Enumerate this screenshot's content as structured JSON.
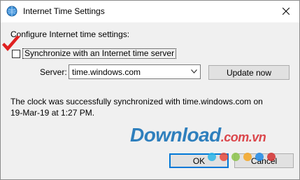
{
  "window": {
    "title": "Internet Time Settings"
  },
  "main": {
    "section_label": "Configure Internet time settings:",
    "sync_label": "Synchronize with an Internet time server",
    "sync_checked": false,
    "server_label": "Server:",
    "server_value": "time.windows.com",
    "update_label": "Update now",
    "status_line1": "The clock was successfully synchronized with time.windows.com on",
    "status_line2": "19-Mar-19 at 1:27 PM."
  },
  "buttons": {
    "ok": "OK",
    "cancel": "Cancel"
  },
  "watermark": {
    "text": "Download",
    "domain": ".com.vn",
    "dot_colors": [
      "#2bb5e8",
      "#e84a3c",
      "#8bc34a",
      "#f5a623",
      "#1e88e5",
      "#d32f2f"
    ]
  },
  "icons": {
    "window_icon": "clock-globe-icon",
    "close": "close-icon",
    "dropdown": "chevron-down-icon",
    "annotation": "red-checkmark-icon"
  },
  "colors": {
    "ok_border": "#0078d7",
    "checkmark_red": "#e02020"
  }
}
